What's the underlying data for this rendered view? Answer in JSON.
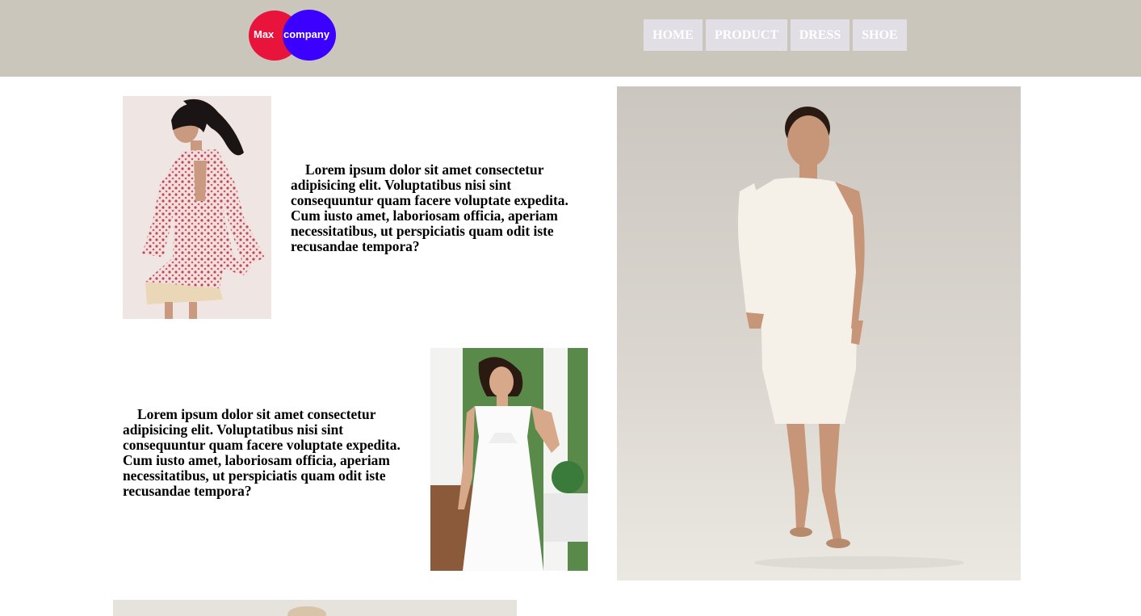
{
  "header": {
    "logo": {
      "word1": "Max",
      "word2": "company",
      "color1": "#e8143c",
      "color2": "#3b00ff"
    },
    "background": "#cac6bb",
    "nav": [
      {
        "label": "HOME"
      },
      {
        "label": "PRODUCT"
      },
      {
        "label": "DRESS"
      },
      {
        "label": "SHOE"
      }
    ]
  },
  "main": {
    "items": [
      {
        "text": "Lorem ipsum dolor sit amet consectetur adipisicing elit. Voluptatibus nisi sint consequuntur quam facere voluptate expedita. Cum iusto amet, laboriosam officia, aperiam necessitatibus, ut perspiciatis quam odit iste recusandae tempora?",
        "image": "floral-bell-sleeve-dress-photo"
      },
      {
        "text": "Lorem ipsum dolor sit amet consectetur adipisicing elit. Voluptatibus nisi sint consequuntur quam facere voluptate expedita. Cum iusto amet, laboriosam officia, aperiam necessitatibus, ut perspiciatis quam odit iste recusandae tempora?",
        "image": "white-tie-front-dress-photo"
      }
    ],
    "feature_image": "white-one-shoulder-dress-photo"
  }
}
